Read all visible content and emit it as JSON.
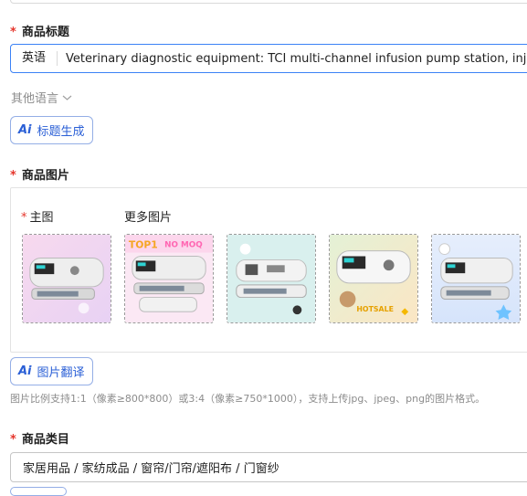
{
  "title_section": {
    "label": "商品标题",
    "language": "英语",
    "value": "Veterinary diagnostic equipment: TCI multi-channel infusion pump station, injectio",
    "other_languages": "其他语言",
    "ai_button": "标题生成"
  },
  "image_section": {
    "label": "商品图片",
    "main_image_label": "主图",
    "more_images_label": "更多图片",
    "thumbnails": [
      {
        "name": "main-image",
        "badge": ""
      },
      {
        "name": "more-image-1",
        "badge": "TOP1 NO MOQ"
      },
      {
        "name": "more-image-2",
        "badge": ""
      },
      {
        "name": "more-image-3",
        "badge": "HOTSALE"
      },
      {
        "name": "more-image-4",
        "badge": ""
      }
    ],
    "badge_top": "TOP1",
    "badge_moq": "NO MOQ",
    "badge_hot": "HOTSALE",
    "ai_button": "图片翻译",
    "hint": "图片比例支持1:1（像素≥800*800）或3:4（像素≥750*1000），支持上传jpg、jpeg、png的图片格式。"
  },
  "category_section": {
    "label": "商品类目",
    "value": "家居用品 / 家纺成品 / 窗帘/门帘/遮阳布 / 门窗纱"
  },
  "ai_prefix": "Ai",
  "required_mark": "*",
  "colors": {
    "required": "#e5352b",
    "accent": "#2a5fd6",
    "focus_border": "#3b82f6"
  }
}
